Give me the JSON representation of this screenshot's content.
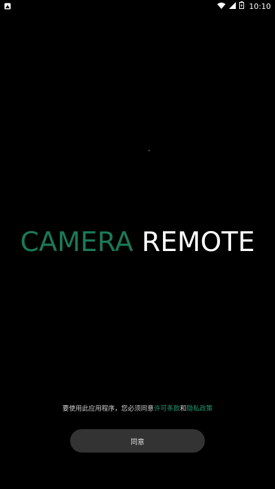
{
  "status_bar": {
    "time": "10:10",
    "icons": [
      "notification-icon",
      "wifi-icon",
      "signal-icon",
      "battery-icon"
    ]
  },
  "logo": {
    "part1": "CAMERA",
    "part2": "REMOTE",
    "accent_color": "#1a7a57"
  },
  "consent": {
    "prefix": "要使用此应用程序，您必须同意",
    "terms_link": "许可条款",
    "conjunction": "和",
    "privacy_link": "隐私政策"
  },
  "agree_button": {
    "label": "同意"
  }
}
